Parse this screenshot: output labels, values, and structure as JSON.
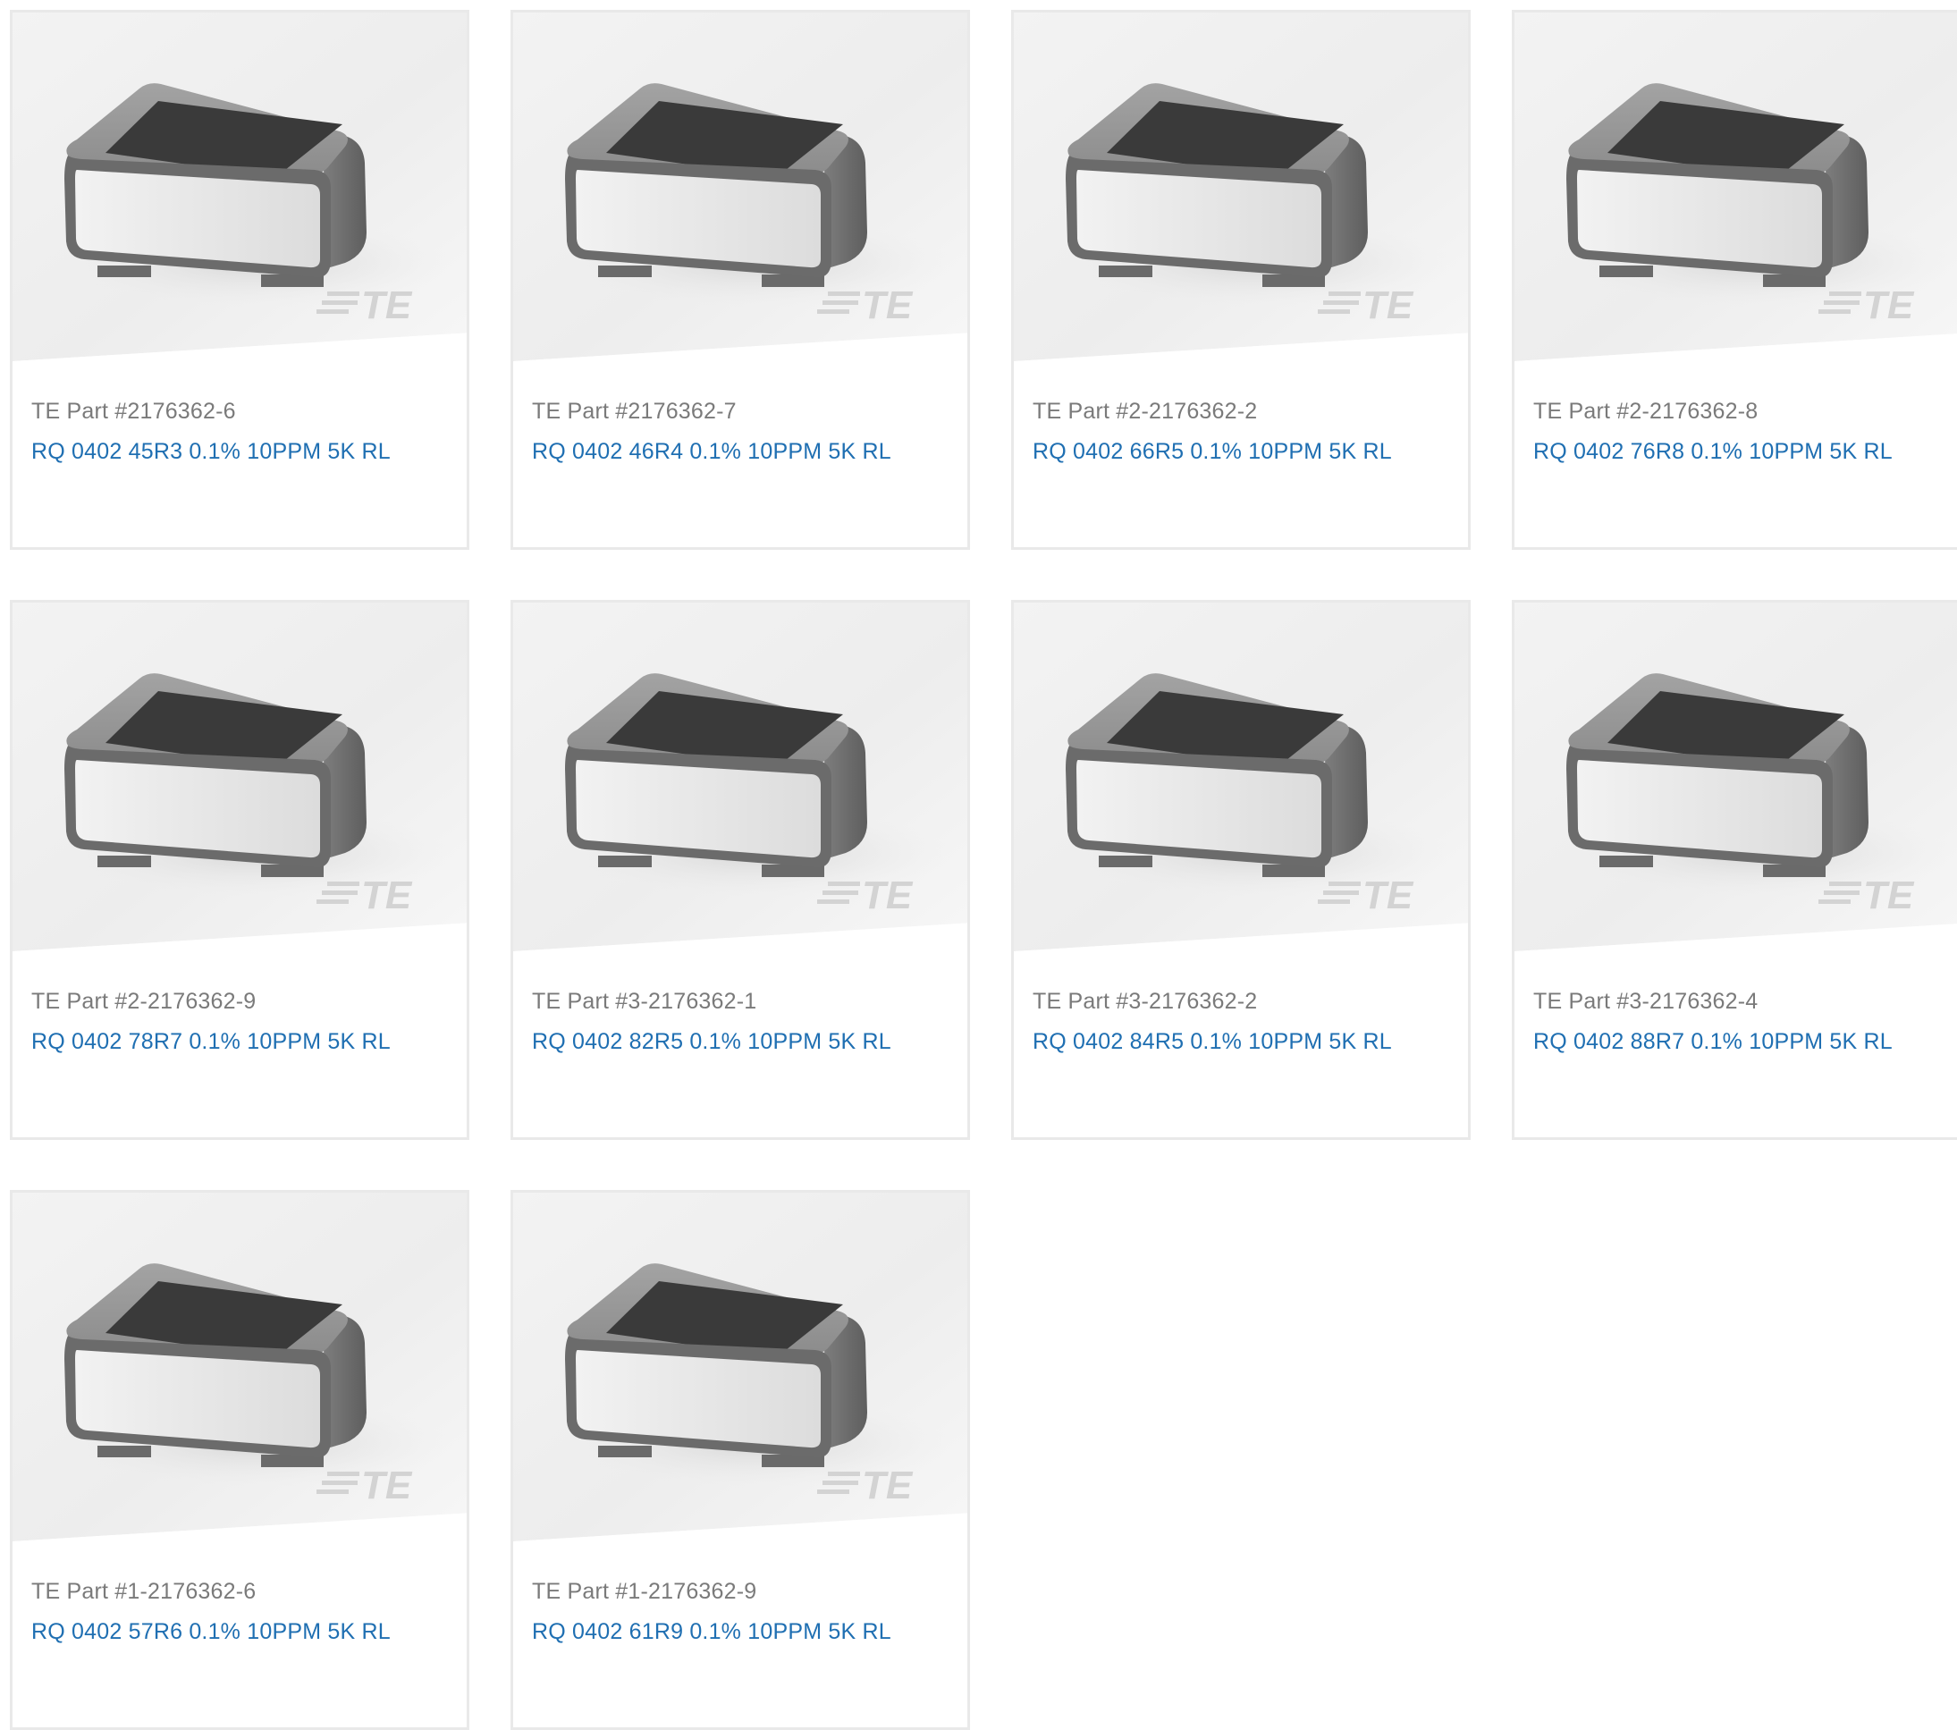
{
  "products": [
    {
      "part_label": "TE Part #2176362-6",
      "description": "RQ 0402 45R3 0.1% 10PPM 5K RL",
      "image_icon": "chip-resistor-image",
      "watermark": "TE"
    },
    {
      "part_label": "TE Part #2176362-7",
      "description": "RQ 0402 46R4 0.1% 10PPM 5K RL",
      "image_icon": "chip-resistor-image",
      "watermark": "TE"
    },
    {
      "part_label": "TE Part #2-2176362-2",
      "description": "RQ 0402 66R5 0.1% 10PPM 5K RL",
      "image_icon": "chip-resistor-image",
      "watermark": "TE"
    },
    {
      "part_label": "TE Part #2-2176362-8",
      "description": "RQ 0402 76R8 0.1% 10PPM 5K RL",
      "image_icon": "chip-resistor-image",
      "watermark": "TE"
    },
    {
      "part_label": "TE Part #2-2176362-9",
      "description": "RQ 0402 78R7 0.1% 10PPM 5K RL",
      "image_icon": "chip-resistor-image",
      "watermark": "TE"
    },
    {
      "part_label": "TE Part #3-2176362-1",
      "description": "RQ 0402 82R5 0.1% 10PPM 5K RL",
      "image_icon": "chip-resistor-image",
      "watermark": "TE"
    },
    {
      "part_label": "TE Part #3-2176362-2",
      "description": "RQ 0402 84R5 0.1% 10PPM 5K RL",
      "image_icon": "chip-resistor-image",
      "watermark": "TE"
    },
    {
      "part_label": "TE Part #3-2176362-4",
      "description": "RQ 0402 88R7 0.1% 10PPM 5K RL",
      "image_icon": "chip-resistor-image",
      "watermark": "TE"
    },
    {
      "part_label": "TE Part #1-2176362-6",
      "description": "RQ 0402 57R6 0.1% 10PPM 5K RL",
      "image_icon": "chip-resistor-image",
      "watermark": "TE"
    },
    {
      "part_label": "TE Part #1-2176362-9",
      "description": "RQ 0402 61R9 0.1% 10PPM 5K RL",
      "image_icon": "chip-resistor-image",
      "watermark": "TE"
    }
  ],
  "colors": {
    "part_label": "#7a7a7a",
    "description_link": "#1f6fb2",
    "card_border": "#e9e9e9"
  }
}
